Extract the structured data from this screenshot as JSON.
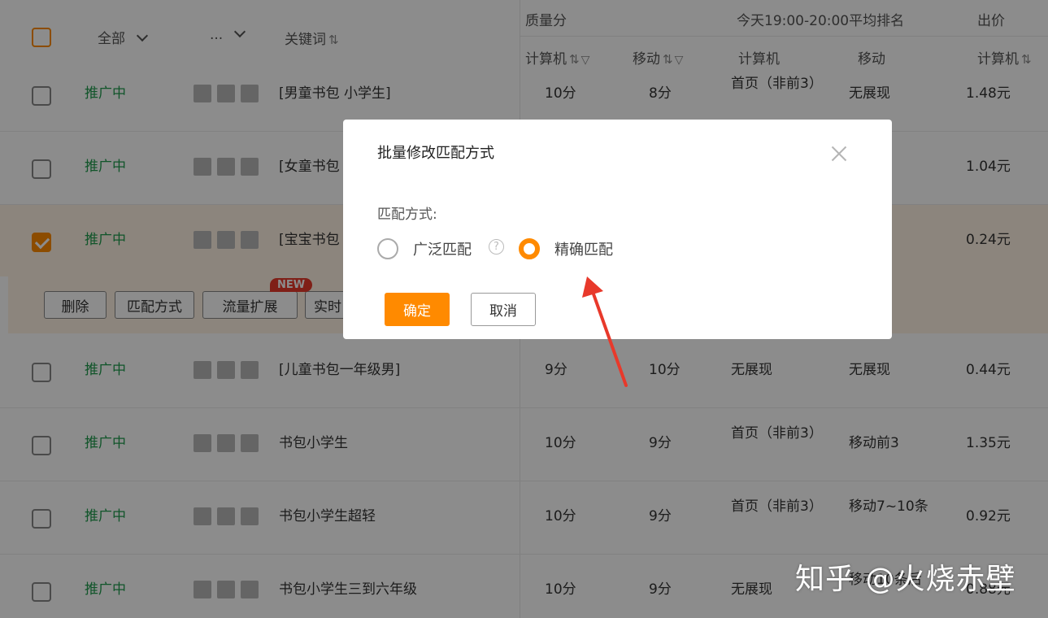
{
  "header": {
    "all_label": "全部",
    "ellipsis_label": "...",
    "keyword_label": "关键词",
    "quality_label": "质量分",
    "rank_label": "今天19:00-20:00平均排名",
    "bid_label": "出价",
    "sub_computer": "计算机",
    "sub_mobile": "移动",
    "sub_computer2": "计算机",
    "sub_mobile2": "移动",
    "sub_bid_computer": "计算机"
  },
  "rows_top": [
    {
      "status": "推广中",
      "keyword": "[男童书包 小学生]",
      "q_pc": "10分",
      "q_mobile": "8分",
      "rank_pc": "首页（非前3）",
      "rank_mobile": "无展现",
      "bid": "1.48元"
    },
    {
      "status": "推广中",
      "keyword": "[女童书包",
      "q_pc": "",
      "q_mobile": "",
      "rank_pc": "",
      "rank_mobile": "现",
      "bid": "1.04元"
    },
    {
      "status": "推广中",
      "keyword": "[宝宝书包",
      "q_pc": "",
      "q_mobile": "",
      "rank_pc": "",
      "rank_mobile": "现",
      "bid": "0.24元"
    }
  ],
  "actionbar": {
    "delete": "删除",
    "match": "匹配方式",
    "traffic": "流量扩展",
    "realtime": "实时",
    "new_badge": "NEW"
  },
  "rows_bottom": [
    {
      "status": "推广中",
      "keyword": "[儿童书包一年级男]",
      "q_pc": "9分",
      "q_mobile": "10分",
      "rank_pc": "无展现",
      "rank_mobile": "无展现",
      "bid": "0.44元"
    },
    {
      "status": "推广中",
      "keyword": "书包小学生",
      "q_pc": "10分",
      "q_mobile": "9分",
      "rank_pc": "首页（非前3）",
      "rank_mobile": "移动前3",
      "bid": "1.35元"
    },
    {
      "status": "推广中",
      "keyword": "书包小学生超轻",
      "q_pc": "10分",
      "q_mobile": "9分",
      "rank_pc": "首页（非前3）",
      "rank_mobile": "移动7~10条",
      "bid": "0.92元"
    },
    {
      "status": "推广中",
      "keyword": "书包小学生三到六年级",
      "q_pc": "10分",
      "q_mobile": "9分",
      "rank_pc": "无展现",
      "rank_mobile": "移动10条后",
      "bid": "0.88元"
    }
  ],
  "modal": {
    "title": "批量修改匹配方式",
    "field_label": "匹配方式:",
    "option_broad": "广泛匹配",
    "option_exact": "精确匹配",
    "selected": "精确匹配",
    "help": "?",
    "confirm": "确定",
    "cancel": "取消"
  },
  "watermark": "知乎 @火烧赤壁",
  "colors": {
    "accent": "#ff8a00",
    "status_green": "#1f9b4e",
    "annotation_arrow": "#e8392b"
  }
}
